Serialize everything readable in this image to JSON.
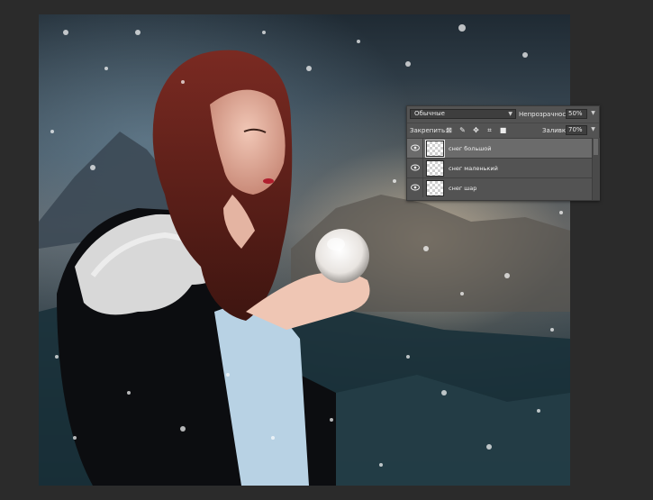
{
  "layers_panel": {
    "blend_mode": "Обычные",
    "opacity_label": "Непрозрачность:",
    "opacity_value": "50%",
    "lock_label": "Закрепить:",
    "fill_label": "Заливка:",
    "fill_value": "70%",
    "lock_icons": [
      "lock-transparent-icon",
      "lock-paint-icon",
      "lock-move-icon",
      "lock-artboard-icon",
      "lock-all-icon"
    ],
    "layers": [
      {
        "name": "снег большой",
        "selected": true
      },
      {
        "name": "снег маленький",
        "selected": false
      },
      {
        "name": "снег шар",
        "selected": false
      }
    ]
  },
  "colors": {
    "app_background": "#2b2b2b",
    "panel_background": "#535353",
    "selected_layer": "#6b6b6b"
  }
}
